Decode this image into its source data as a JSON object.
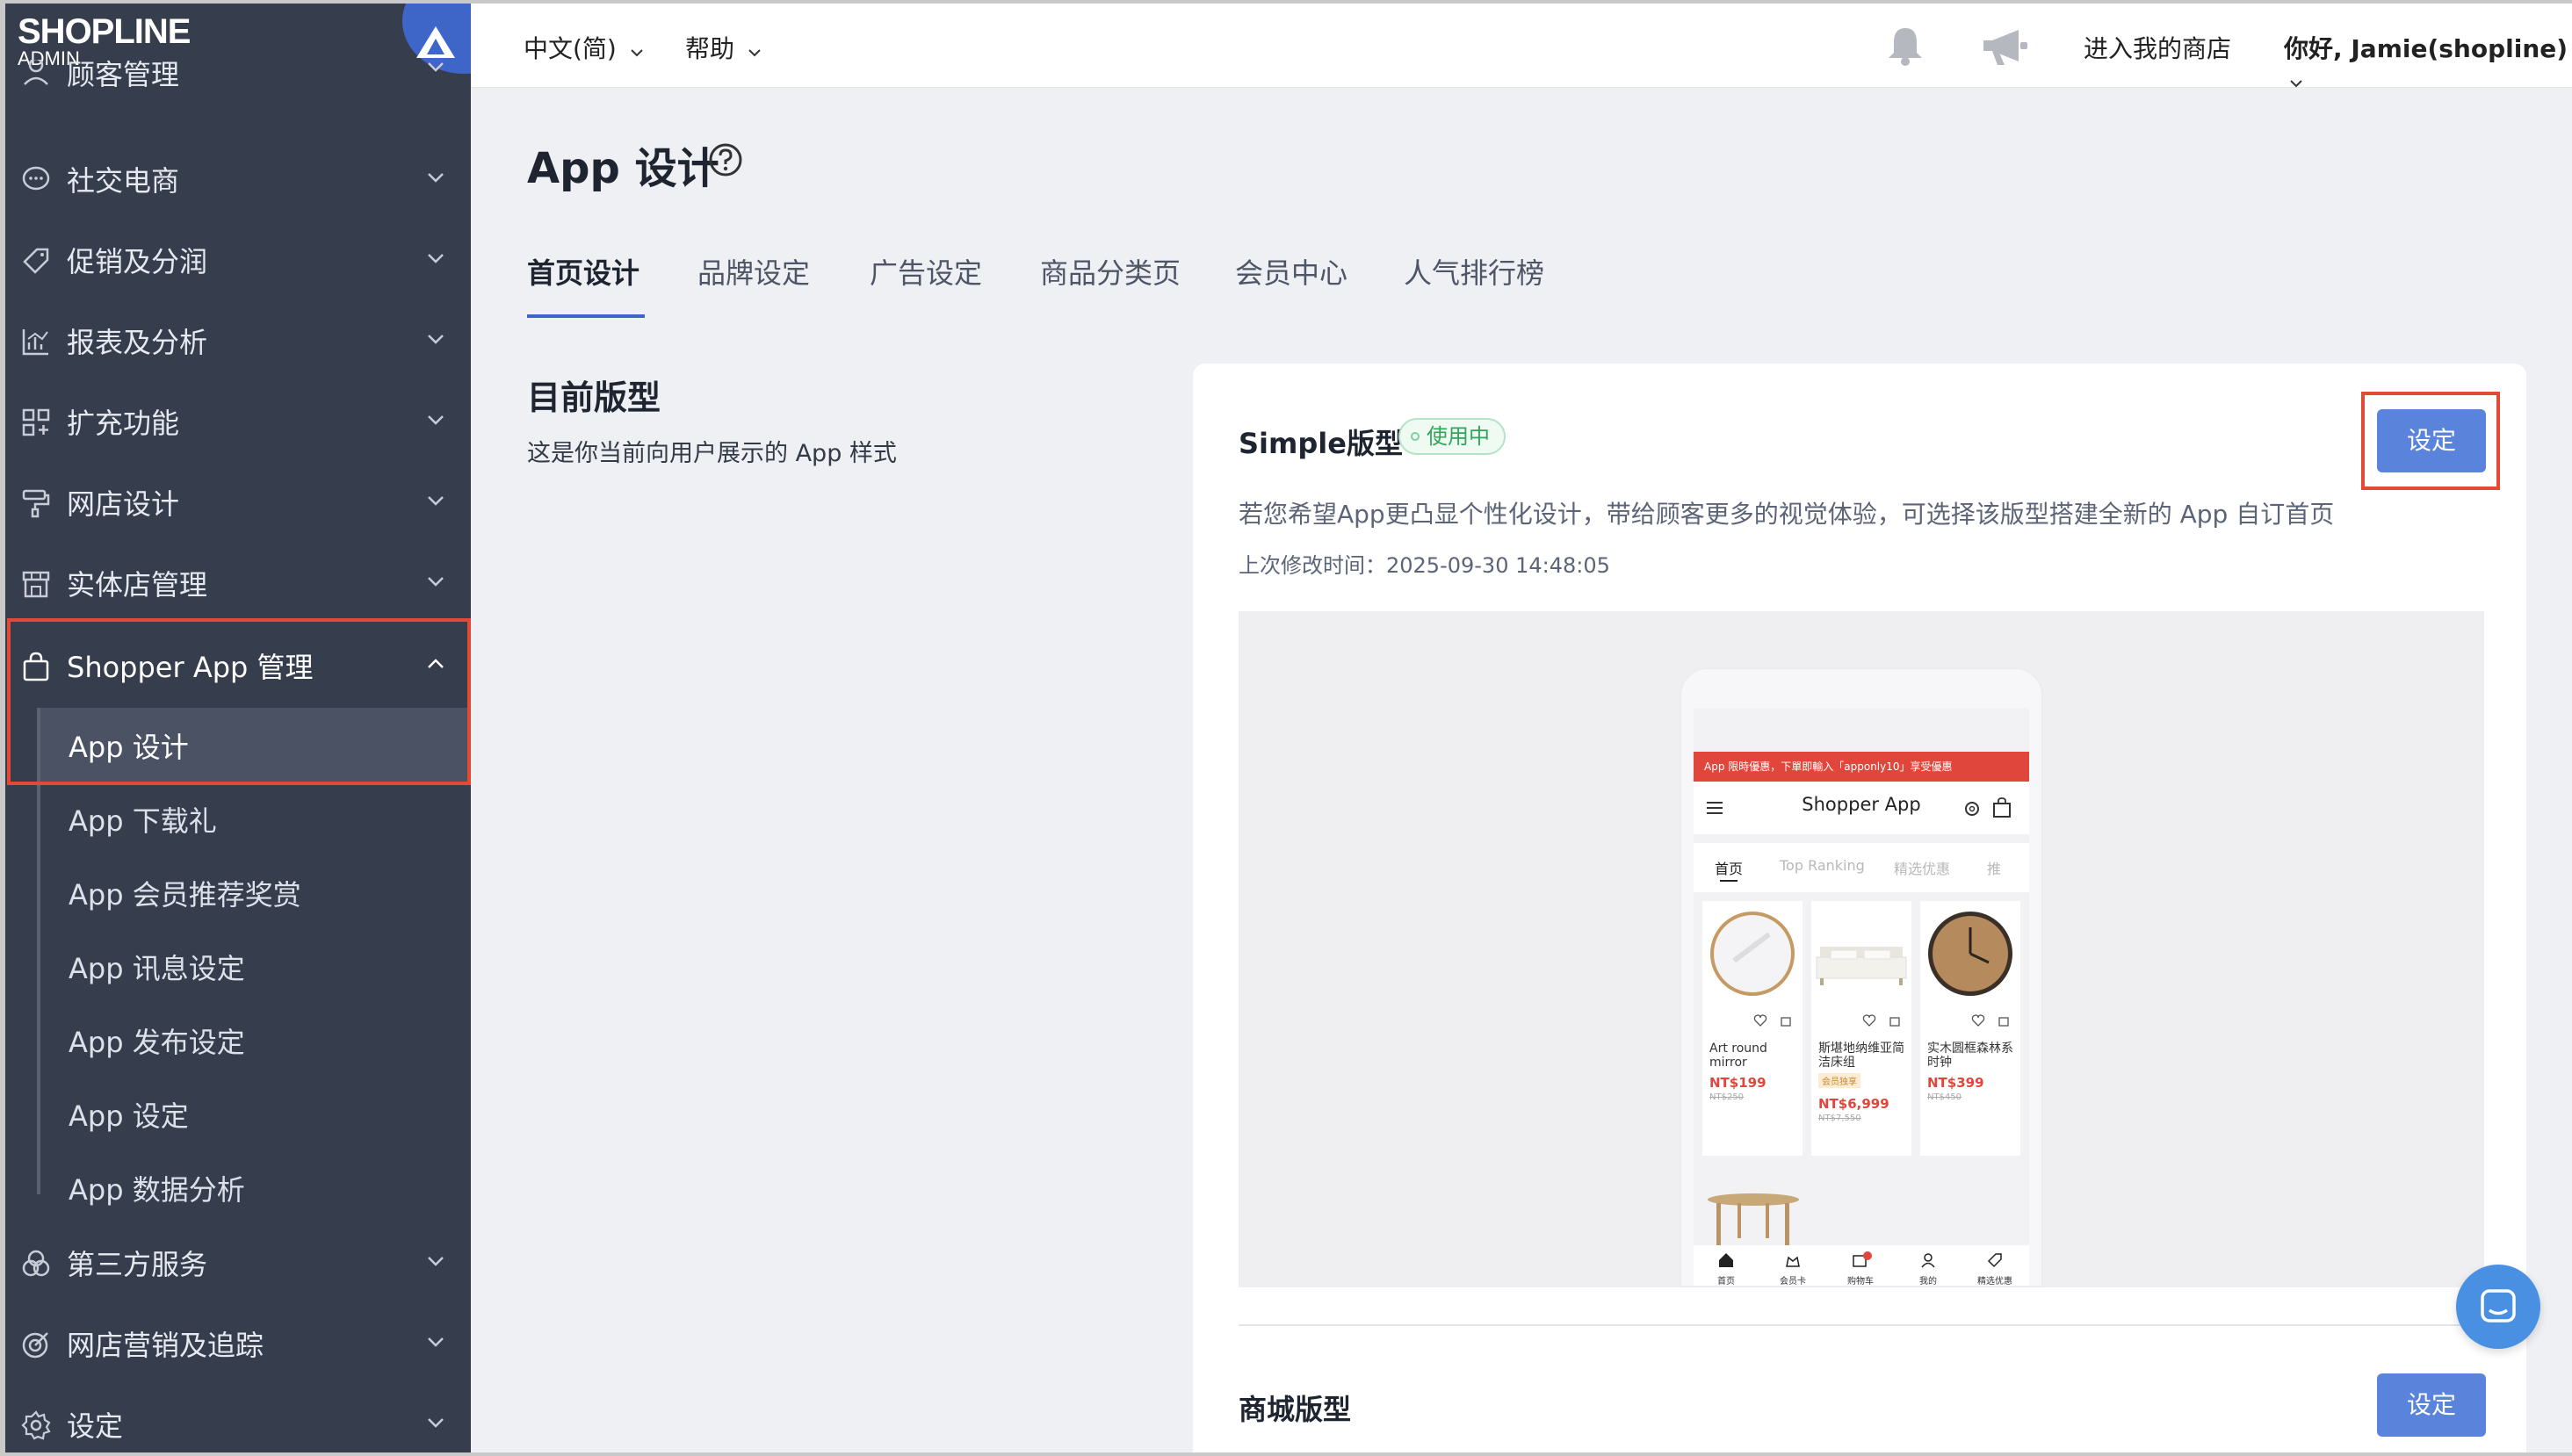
{
  "brand": {
    "logo": "SHOPLINE",
    "sub": "ADMIN"
  },
  "sidebar": {
    "items": [
      {
        "label": "顾客管理",
        "icon": "customer-icon"
      },
      {
        "label": "社交电商",
        "icon": "chat-bubble-icon"
      },
      {
        "label": "促销及分润",
        "icon": "tag-icon"
      },
      {
        "label": "报表及分析",
        "icon": "chart-icon"
      },
      {
        "label": "扩充功能",
        "icon": "grid-plus-icon"
      },
      {
        "label": "网店设计",
        "icon": "paint-roller-icon"
      },
      {
        "label": "实体店管理",
        "icon": "store-icon"
      },
      {
        "label": "Shopper App 管理",
        "icon": "shopping-bag-icon"
      },
      {
        "label": "第三方服务",
        "icon": "circles-icon"
      },
      {
        "label": "网店营销及追踪",
        "icon": "target-icon"
      },
      {
        "label": "设定",
        "icon": "gear-icon"
      }
    ],
    "sub_items": [
      "App 设计",
      "App 下载礼",
      "App 会员推荐奖赏",
      "App 讯息设定",
      "App 发布设定",
      "App 设定",
      "App 数据分析"
    ]
  },
  "topbar": {
    "language": "中文(简)",
    "help": "帮助",
    "enter_store": "进入我的商店",
    "greeting": "你好, Jamie(shopline)"
  },
  "page": {
    "title": "App 设计",
    "tabs": [
      "首页设计",
      "品牌设定",
      "广告设定",
      "商品分类页",
      "会员中心",
      "人气排行榜"
    ],
    "section_title": "目前版型",
    "section_desc": "这是你当前向用户展示的 App 样式"
  },
  "template": {
    "name": "Simple版型",
    "badge": "使用中",
    "set_label": "设定",
    "desc": "若您希望App更凸显个性化设计，带给顾客更多的视觉体验，可选择该版型搭建全新的 App 自订首页",
    "time": "上次修改时间：2025-09-30 14:48:05"
  },
  "template2": {
    "name": "商城版型",
    "set_label": "设定"
  },
  "phone": {
    "banner": "App 限時優惠，下單即輸入「apponly10」享受優惠",
    "title": "Shopper App",
    "tabs": [
      "首页",
      "Top Ranking",
      "精选优惠",
      "推"
    ],
    "products": [
      {
        "name": "Art round mirror",
        "price": "NT$199",
        "old": "NT$250",
        "member": ""
      },
      {
        "name": "斯堪地纳维亚简洁床组",
        "price": "NT$6,999",
        "old": "NT$7,550",
        "member": "会员独享"
      },
      {
        "name": "实木圆框森林系时钟",
        "price": "NT$399",
        "old": "NT$450",
        "member": ""
      }
    ],
    "nav": [
      "首页",
      "会员卡",
      "购物车",
      "我的",
      "精选优惠"
    ]
  },
  "colors": {
    "accent": "#3e66c9",
    "button": "#5a84dc",
    "sidebar": "#363d4d",
    "highlight": "#e24a36"
  }
}
